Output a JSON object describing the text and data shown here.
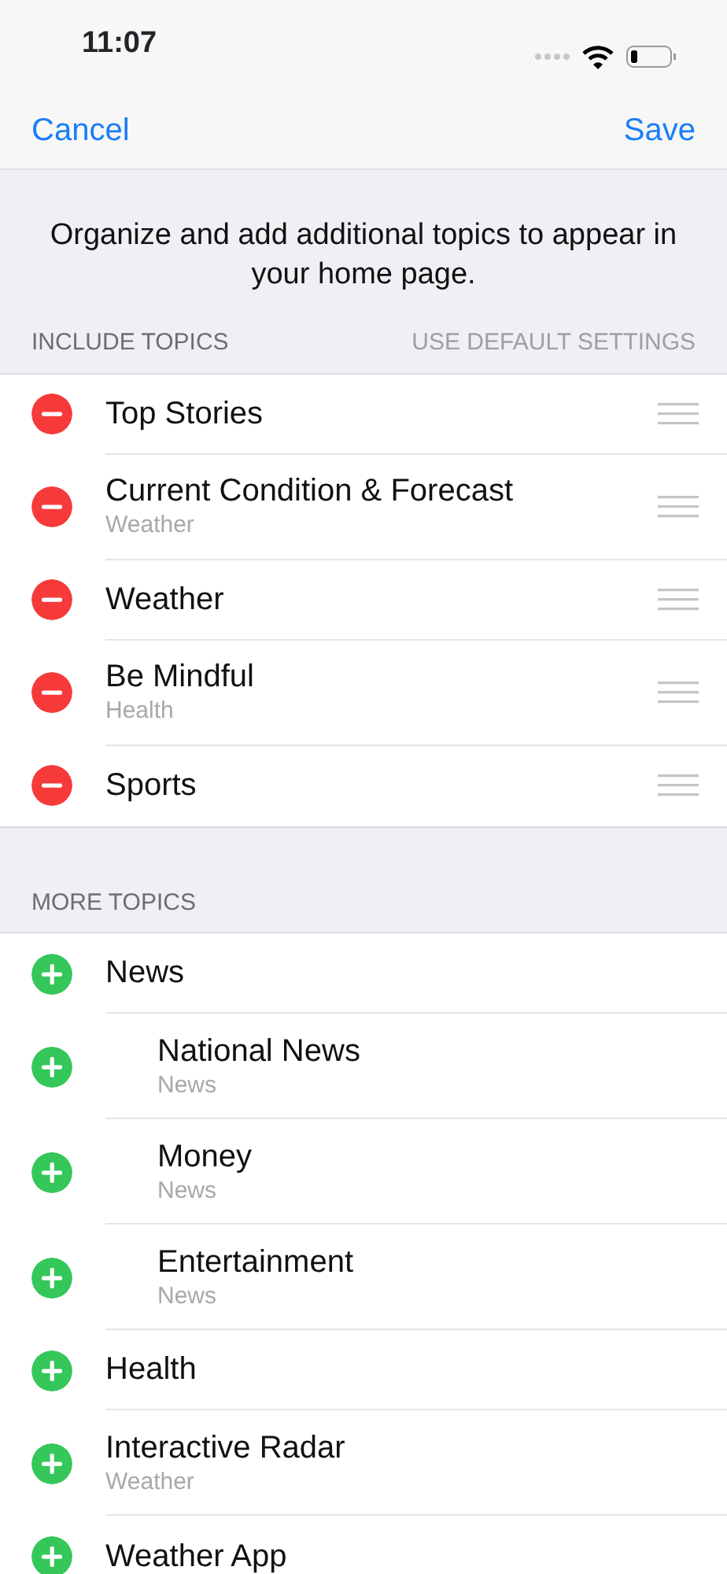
{
  "status_bar": {
    "time": "11:07"
  },
  "nav": {
    "cancel": "Cancel",
    "save": "Save"
  },
  "intro": "Organize and add additional topics to appear in your home page.",
  "included": {
    "header": "INCLUDE TOPICS",
    "action": {
      "label": "USE DEFAULT SETTINGS",
      "disabled": true
    },
    "items": [
      {
        "title": "Top Stories"
      },
      {
        "title": "Current Condition & Forecast",
        "subtitle": "Weather"
      },
      {
        "title": "Weather"
      },
      {
        "title": "Be Mindful",
        "subtitle": "Health"
      },
      {
        "title": "Sports"
      }
    ]
  },
  "more": {
    "header": "MORE TOPICS",
    "items": [
      {
        "title": "News",
        "children": [
          {
            "title": "National News",
            "subtitle": "News"
          },
          {
            "title": "Money",
            "subtitle": "News"
          },
          {
            "title": "Entertainment",
            "subtitle": "News"
          }
        ]
      },
      {
        "title": "Health"
      },
      {
        "title": "Interactive Radar",
        "subtitle": "Weather"
      },
      {
        "title": "Weather App"
      }
    ]
  }
}
